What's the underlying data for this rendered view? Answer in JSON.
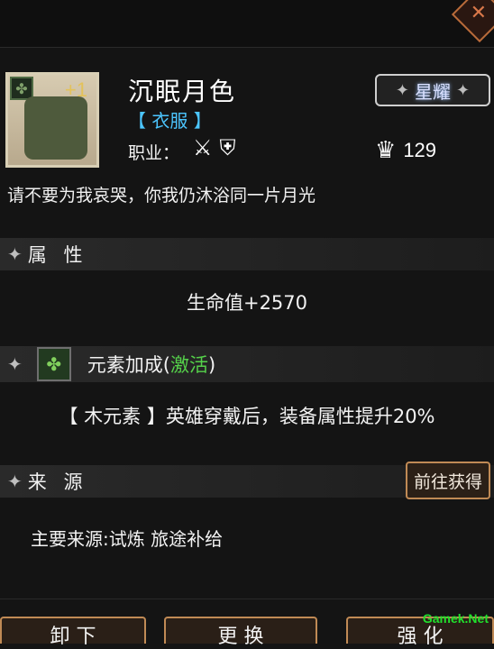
{
  "item": {
    "level_badge": "+1",
    "name": "沉眠月色",
    "type": "【 衣服 】",
    "job_label": "职业：",
    "rarity": "星耀",
    "score": "129",
    "description": "请不要为我哀哭，你我仍沐浴同一片月光"
  },
  "attributes": {
    "title": "属 性",
    "hp": "生命值+2570"
  },
  "element": {
    "title_main": "元素加成(",
    "status": "激活",
    "title_end": ")",
    "text": "【 木元素 】英雄穿戴后，装备属性提升20%"
  },
  "source": {
    "title": "来 源",
    "goto_label": "前往获得",
    "text": "主要来源:试炼 旅途补给"
  },
  "bottom_buttons": [
    "卸 下",
    "更 换",
    "强 化"
  ],
  "watermark": "Gamek.Net",
  "colors": {
    "type_text": "#4cc6ff",
    "activated": "#55d14a",
    "button_border": "#c08a55"
  },
  "icons": [
    "plus-icon",
    "crown-icon",
    "leaf-element-icon",
    "job-class-icon",
    "shield-icon"
  ]
}
